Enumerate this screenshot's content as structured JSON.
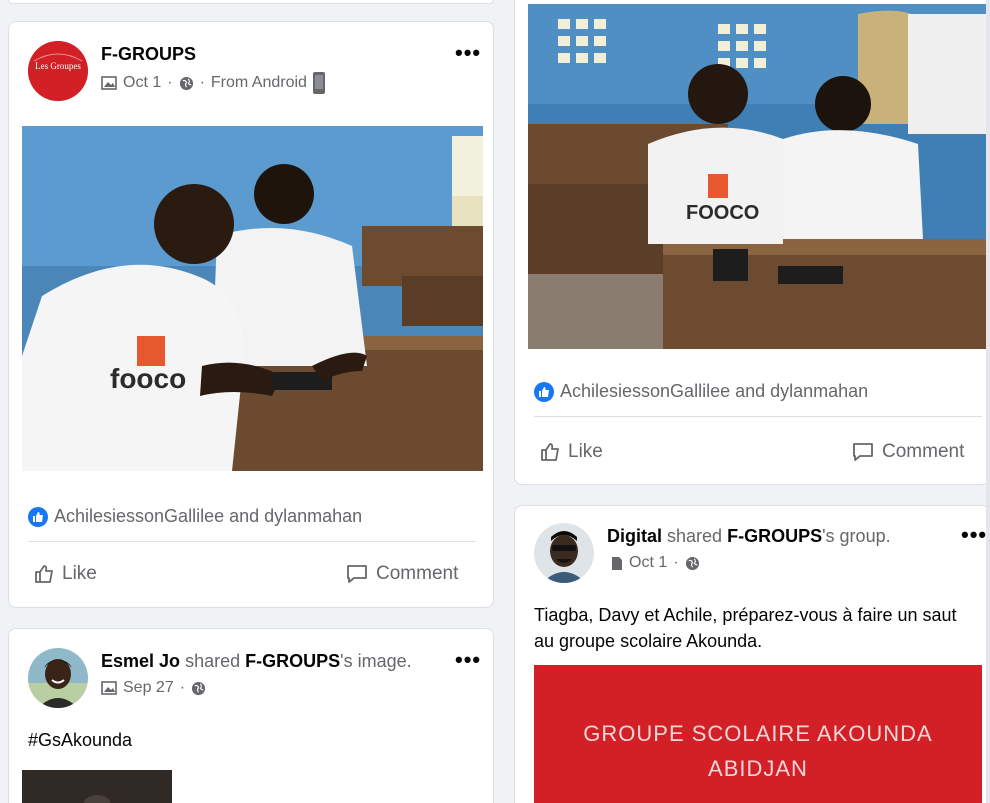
{
  "post1": {
    "author": "F-GROUPS",
    "avatar_text": "Les Groupes",
    "date": "Oct 1",
    "source": "From Android",
    "reactions": "AchilesiessonGallilee and dylanmahan",
    "like_label": "Like",
    "comment_label": "Comment"
  },
  "post2": {
    "reactions": "AchilesiessonGallilee and dylanmahan",
    "like_label": "Like",
    "comment_label": "Comment"
  },
  "post3": {
    "author": "Esmel Jo",
    "shared_text": "shared",
    "owner": "F-GROUPS",
    "owner_suffix": "'s image.",
    "date": "Sep 27",
    "body": "#GsAkounda"
  },
  "post4": {
    "author": "Digital",
    "shared_text": "shared",
    "owner": "F-GROUPS",
    "owner_suffix": "'s group.",
    "date": "Oct 1",
    "body": "Tiagba, Davy et Achile, préparez-vous à faire un saut au groupe scolaire Akounda.",
    "banner_line1": "GROUPE  SCOLAIRE AKOUNDA",
    "banner_line2": "ABIDJAN"
  },
  "colors": {
    "brand_red": "#d32027",
    "like_blue": "#1877f2",
    "muted": "#65676b"
  },
  "icons": [
    "photo-icon",
    "globe-icon",
    "phone-icon",
    "more-icon",
    "like-icon",
    "comment-icon",
    "document-icon"
  ]
}
